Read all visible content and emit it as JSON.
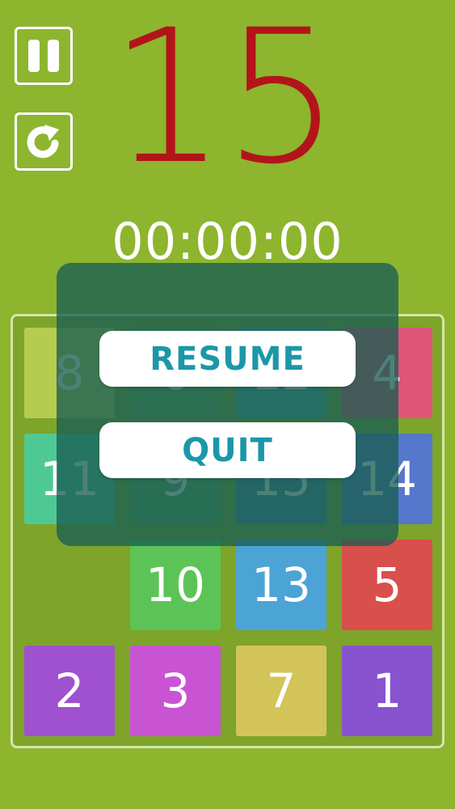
{
  "colors": {
    "background": "#8db52e",
    "title": "#b3141a",
    "board_bg": "#7ea42a",
    "overlay_text": "#1c97a8"
  },
  "header": {
    "title": "15",
    "timer": "00:00:00",
    "pause_icon": "pause-icon",
    "restart_icon": "restart-icon"
  },
  "board": {
    "tiles": [
      {
        "label": "8",
        "color": "#b6cc4f",
        "row": 0,
        "col": 0
      },
      {
        "label": "6",
        "color": "#6aa74e",
        "row": 0,
        "col": 1
      },
      {
        "label": "12",
        "color": "#4aa89f",
        "row": 0,
        "col": 2
      },
      {
        "label": "4",
        "color": "#dd5577",
        "row": 0,
        "col": 3
      },
      {
        "label": "11",
        "color": "#4fc993",
        "row": 1,
        "col": 0
      },
      {
        "label": "9",
        "color": "#5eaa5c",
        "row": 1,
        "col": 1
      },
      {
        "label": "15",
        "color": "#4a7fae",
        "row": 1,
        "col": 2
      },
      {
        "label": "14",
        "color": "#5577cc",
        "row": 1,
        "col": 3
      },
      {
        "label": "10",
        "color": "#5cc457",
        "row": 2,
        "col": 1
      },
      {
        "label": "13",
        "color": "#4ca4d6",
        "row": 2,
        "col": 2
      },
      {
        "label": "5",
        "color": "#d94f4b",
        "row": 2,
        "col": 3
      },
      {
        "label": "2",
        "color": "#a051cf",
        "row": 3,
        "col": 0
      },
      {
        "label": "3",
        "color": "#c954d3",
        "row": 3,
        "col": 1
      },
      {
        "label": "7",
        "color": "#d3c45a",
        "row": 3,
        "col": 2
      },
      {
        "label": "1",
        "color": "#8853cf",
        "row": 3,
        "col": 3
      }
    ]
  },
  "pause_menu": {
    "resume_label": "RESUME",
    "quit_label": "QUIT"
  }
}
